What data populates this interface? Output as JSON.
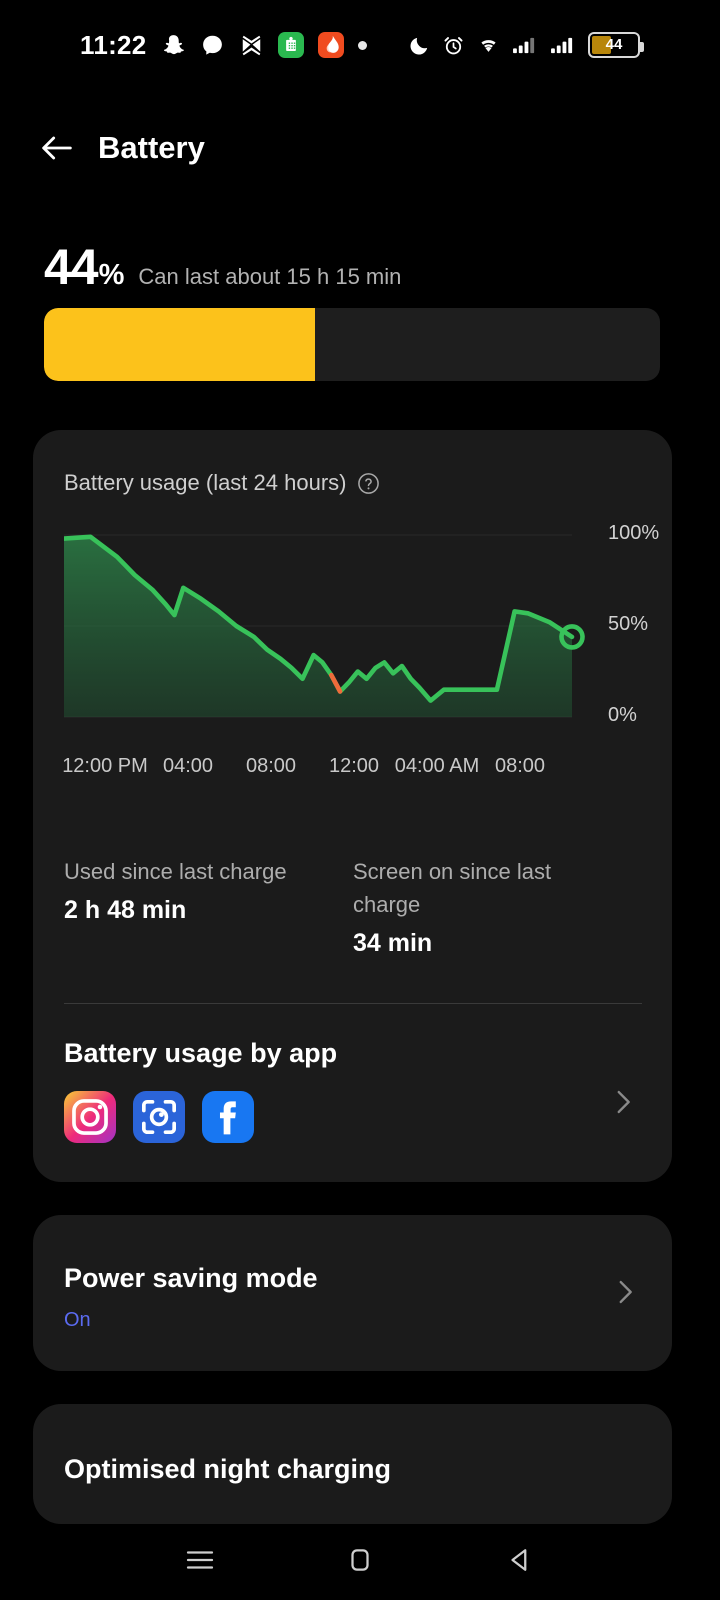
{
  "statusbar": {
    "time": "11:22",
    "left_icons": [
      {
        "name": "snapchat-icon",
        "label": "Snapchat"
      },
      {
        "name": "messenger-icon",
        "label": "Messenger"
      },
      {
        "name": "capcut-icon",
        "label": "CapCut"
      },
      {
        "name": "whatsapp-business-icon",
        "label": "WhatsApp Business"
      },
      {
        "name": "app-notification-icon",
        "label": "Notification"
      },
      {
        "name": "dot-icon",
        "label": "More"
      }
    ],
    "right_icons": [
      {
        "name": "do-not-disturb-moon-icon",
        "label": "Do not disturb"
      },
      {
        "name": "alarm-clock-icon",
        "label": "Alarm set"
      },
      {
        "name": "wifi-icon",
        "label": "Wi-Fi"
      },
      {
        "name": "signal-sim1-icon",
        "label": "SIM 1 signal"
      },
      {
        "name": "signal-sim2-icon",
        "label": "SIM 2 signal"
      }
    ],
    "battery_level": "44"
  },
  "header": {
    "back_label": "Back",
    "title": "Battery"
  },
  "summary": {
    "percent": "44",
    "percent_sign": "%",
    "estimate": "Can last about 15 h 15 min",
    "fill_percent": 44,
    "fill_color": "#FCC21B"
  },
  "usage_card": {
    "title": "Battery usage (last 24 hours)",
    "help_icon": "help-circle-icon",
    "stats": [
      {
        "label": "Used since last charge",
        "value": "2 h 48 min"
      },
      {
        "label": "Screen on since last charge",
        "value": "34 min"
      }
    ],
    "by_app": {
      "title": "Battery usage by app",
      "apps": [
        {
          "name": "instagram-app-icon",
          "label": "Instagram"
        },
        {
          "name": "lens-scanner-app-icon",
          "label": "Scanner"
        },
        {
          "name": "facebook-app-icon",
          "label": "Facebook"
        }
      ],
      "chevron": "chevron-right-icon"
    }
  },
  "chart_data": {
    "type": "area",
    "title": "Battery usage (last 24 hours)",
    "xlabel": "",
    "ylabel": "",
    "ylim": [
      0,
      100
    ],
    "grid": true,
    "legend": "none",
    "ytick_labels": [
      "100%",
      "50%",
      "0%"
    ],
    "ytick_values": [
      100,
      50,
      0
    ],
    "xtick_labels": [
      "12:00 PM",
      "04:00",
      "08:00",
      "12:00",
      "04:00 AM",
      "08:00"
    ],
    "xtick_sublabels": [
      "PM",
      "",
      "",
      "",
      "AM",
      ""
    ],
    "line_color": "#38C25A",
    "charging_color": "#EE6B3B",
    "fill_color": "#1E5433",
    "end_marker": {
      "shape": "ring",
      "value": 44
    },
    "x": [
      0,
      1.2,
      2.4,
      3.2,
      4.0,
      4.6,
      5.0,
      5.4,
      6.2,
      7.0,
      7.8,
      8.6,
      9.2,
      9.8,
      10.3,
      10.8,
      11.3,
      11.7,
      12.1,
      12.5,
      12.9,
      13.3,
      13.7,
      14.1,
      14.5,
      14.9,
      15.3,
      15.7,
      16.1,
      16.6,
      17.2,
      18.4,
      19.6,
      20.4,
      21.0,
      22.0,
      23.0
    ],
    "y": [
      98,
      99,
      88,
      78,
      70,
      62,
      56,
      71,
      65,
      58,
      50,
      44,
      37,
      32,
      27,
      21,
      34,
      30,
      23,
      14,
      19,
      25,
      21,
      27,
      30,
      24,
      28,
      21,
      16,
      9,
      15,
      15,
      15,
      58,
      57,
      52,
      44
    ],
    "series": [
      {
        "name": "Battery level",
        "values": [
          98,
          99,
          88,
          78,
          70,
          62,
          56,
          71,
          65,
          58,
          50,
          44,
          37,
          32,
          27,
          21,
          34,
          30,
          23,
          14,
          19,
          25,
          21,
          27,
          30,
          24,
          28,
          21,
          16,
          9,
          15,
          15,
          15,
          58,
          57,
          52,
          44
        ]
      }
    ]
  },
  "power_saving": {
    "title": "Power saving mode",
    "status": "On",
    "status_color": "#5B6BF0",
    "chevron": "chevron-right-icon"
  },
  "night_charging": {
    "title": "Optimised night charging"
  },
  "navbar": {
    "items": [
      {
        "name": "recents-icon",
        "label": "Recents"
      },
      {
        "name": "home-icon",
        "label": "Home"
      },
      {
        "name": "back-nav-icon",
        "label": "Back"
      }
    ]
  }
}
